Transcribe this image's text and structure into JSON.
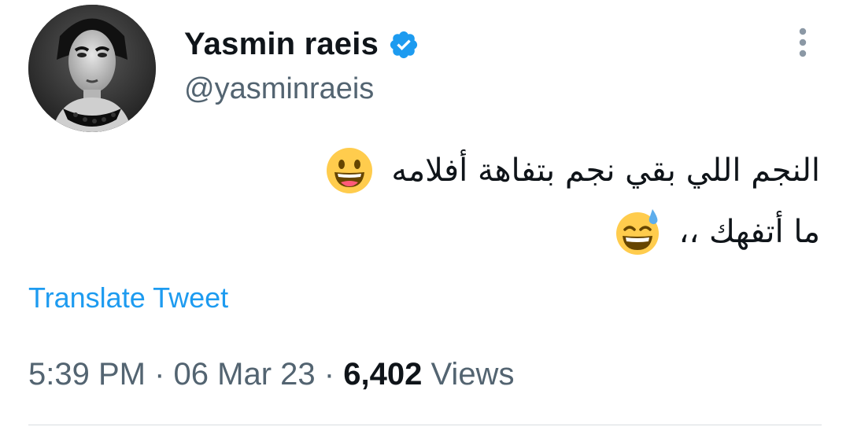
{
  "author": {
    "display_name": "Yasmin raeis",
    "handle": "@yasminraeis",
    "verified": true,
    "verified_color": "#1d9bf0"
  },
  "tweet": {
    "lines": [
      "النجم اللي بقي نجم بتفاهة أفلامه",
      "ما أتفهك ،،"
    ],
    "emojis": [
      "grinning-face",
      "grinning-face-with-sweat"
    ],
    "translate_label": "Translate Tweet"
  },
  "meta": {
    "time": "5:39 PM",
    "separator": "·",
    "date": "06 Mar 23",
    "views_count": "6,402",
    "views_label": "Views"
  },
  "colors": {
    "link": "#1d9bf0",
    "secondary_text": "#536471",
    "primary_text": "#0f1419"
  },
  "icons": {
    "more": "more-vertical-icon",
    "verified": "verified-badge-icon"
  }
}
